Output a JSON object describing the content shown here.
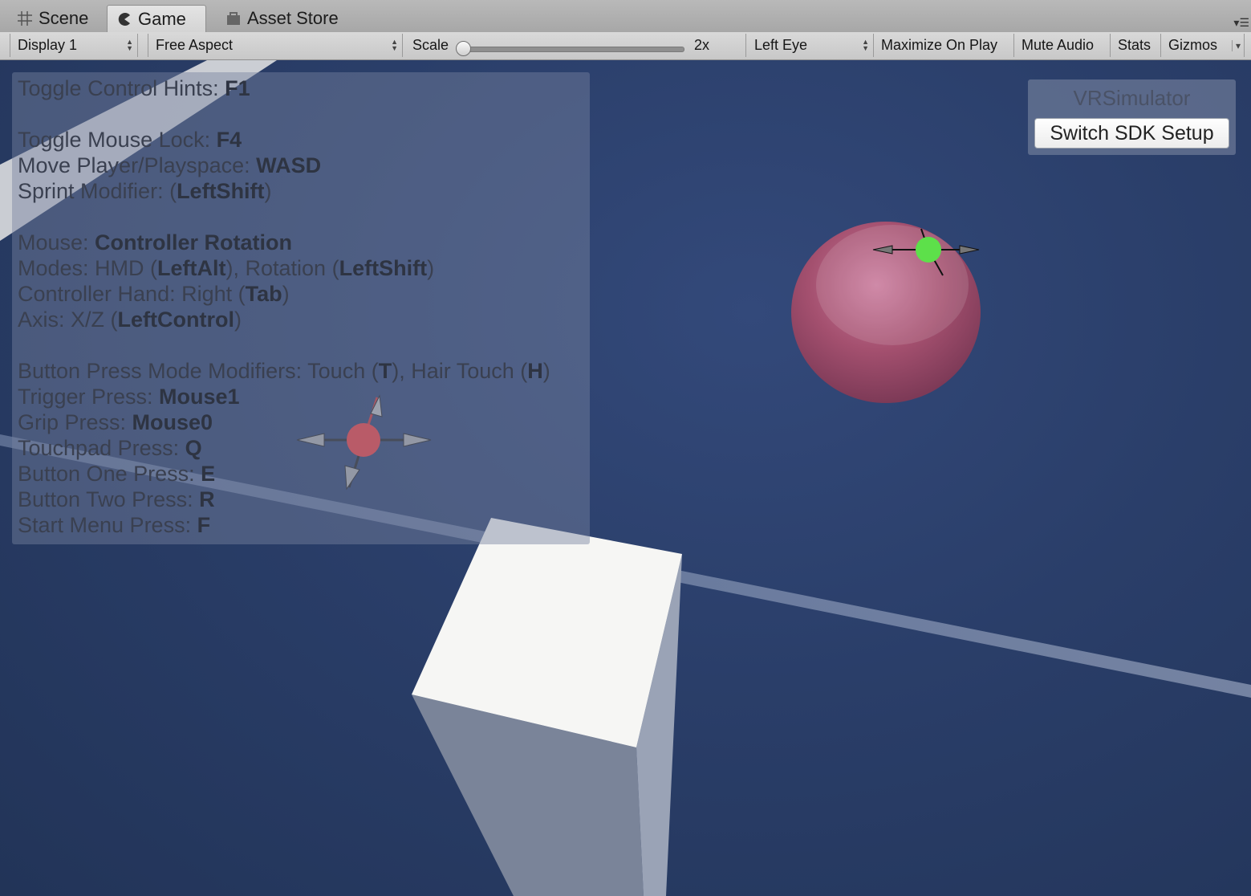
{
  "tabs": [
    {
      "label": "Scene",
      "icon": "grid-icon"
    },
    {
      "label": "Game",
      "icon": "pacman-icon",
      "active": true
    },
    {
      "label": "Asset Store",
      "icon": "store-icon"
    }
  ],
  "toolbar": {
    "display": "Display 1",
    "aspect": "Free Aspect",
    "scale_label": "Scale",
    "scale_value": "2x",
    "eye": "Left Eye",
    "maximize": "Maximize On Play",
    "mute": "Mute Audio",
    "stats": "Stats",
    "gizmos": "Gizmos"
  },
  "hints": {
    "toggle_hints": {
      "label": "Toggle Control Hints: ",
      "key": "F1"
    },
    "mouse_lock": {
      "label": "Toggle Mouse Lock: ",
      "key": "F4"
    },
    "move": {
      "label": "Move Player/Playspace: ",
      "key": "WASD"
    },
    "sprint": {
      "label": "Sprint Modifier: (",
      "key": "LeftShift",
      "end": ")"
    },
    "mouse": {
      "label": "Mouse: ",
      "key": "Controller Rotation"
    },
    "modes": {
      "a": "Modes: HMD (",
      "k1": "LeftAlt",
      "b": "), Rotation (",
      "k2": "LeftShift",
      "c": ")"
    },
    "hand": {
      "a": "Controller Hand: Right (",
      "k": "Tab",
      "b": ")"
    },
    "axis": {
      "a": "Axis: X/Z (",
      "k": "LeftControl",
      "b": ")"
    },
    "press_mode": {
      "a": "Button Press Mode Modifiers: Touch (",
      "k1": "T",
      "b": "), Hair Touch (",
      "k2": "H",
      "c": ")"
    },
    "trigger": {
      "label": "Trigger Press: ",
      "key": "Mouse1"
    },
    "grip": {
      "label": "Grip Press: ",
      "key": "Mouse0"
    },
    "touchpad": {
      "label": "Touchpad Press: ",
      "key": "Q"
    },
    "button_one": {
      "label": "Button One Press: ",
      "key": "E"
    },
    "button_two": {
      "label": "Button Two Press: ",
      "key": "R"
    },
    "start_menu": {
      "label": "Start Menu Press: ",
      "key": "F"
    }
  },
  "vrsim": {
    "title": "VRSimulator",
    "button": "Switch SDK Setup"
  },
  "colors": {
    "background": "#283a63",
    "sphere": "#a0506e",
    "left_controller": "#ee3b3b",
    "right_controller": "#5de04a",
    "cube": "#f6f6f4"
  }
}
